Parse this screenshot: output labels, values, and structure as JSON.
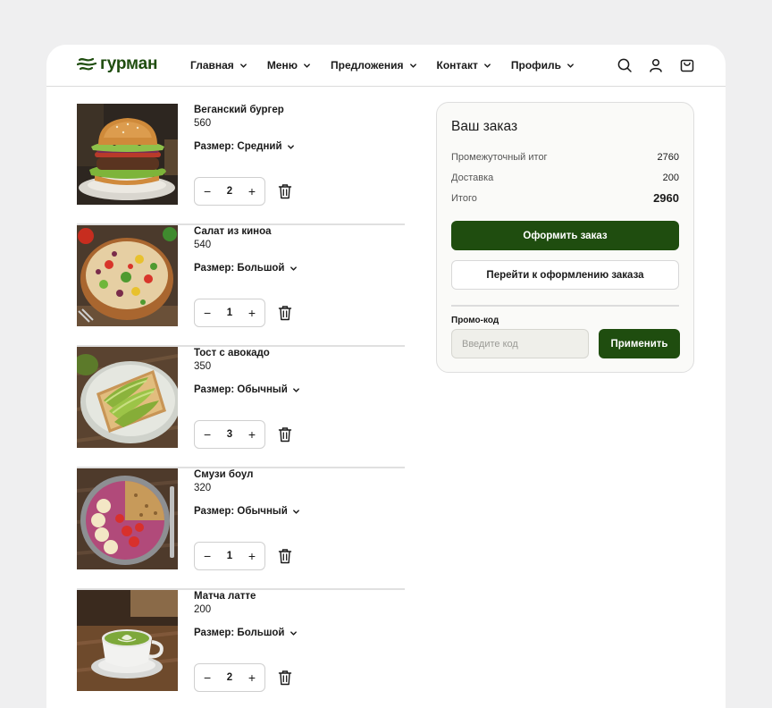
{
  "brand": {
    "name": "гурман",
    "color": "#1f4d0f"
  },
  "nav": [
    {
      "label": "Главная"
    },
    {
      "label": "Меню"
    },
    {
      "label": "Предложения"
    },
    {
      "label": "Контакт"
    },
    {
      "label": "Профиль"
    }
  ],
  "header_icons": [
    "search-icon",
    "user-icon",
    "cart-icon"
  ],
  "cart": {
    "items": [
      {
        "name": "Веганский бургер",
        "price": "560",
        "size": "Размер: Средний",
        "qty": "2",
        "image": "burger"
      },
      {
        "name": "Салат из киноа",
        "price": "540",
        "size": "Размер: Большой",
        "qty": "1",
        "image": "salad"
      },
      {
        "name": "Тост с авокадо",
        "price": "350",
        "size": "Размер: Обычный",
        "qty": "3",
        "image": "avocado-toast"
      },
      {
        "name": "Смузи боул",
        "price": "320",
        "size": "Размер: Обычный",
        "qty": "1",
        "image": "smoothie-bowl"
      },
      {
        "name": "Матча латте",
        "price": "200",
        "size": "Размер: Большой",
        "qty": "2",
        "image": "matcha-latte"
      }
    ],
    "minus": "−",
    "plus": "+"
  },
  "summary": {
    "title": "Ваш заказ",
    "subtotal_label": "Промежуточный итог",
    "subtotal": "2760",
    "delivery_label": "Доставка",
    "delivery": "200",
    "total_label": "Итого",
    "total": "2960",
    "place_order": "Оформить заказ",
    "checkout": "Перейти к оформлению заказа",
    "promo_label": "Промо-код",
    "promo_placeholder": "Введите код",
    "promo_value": "",
    "apply": "Применить"
  }
}
